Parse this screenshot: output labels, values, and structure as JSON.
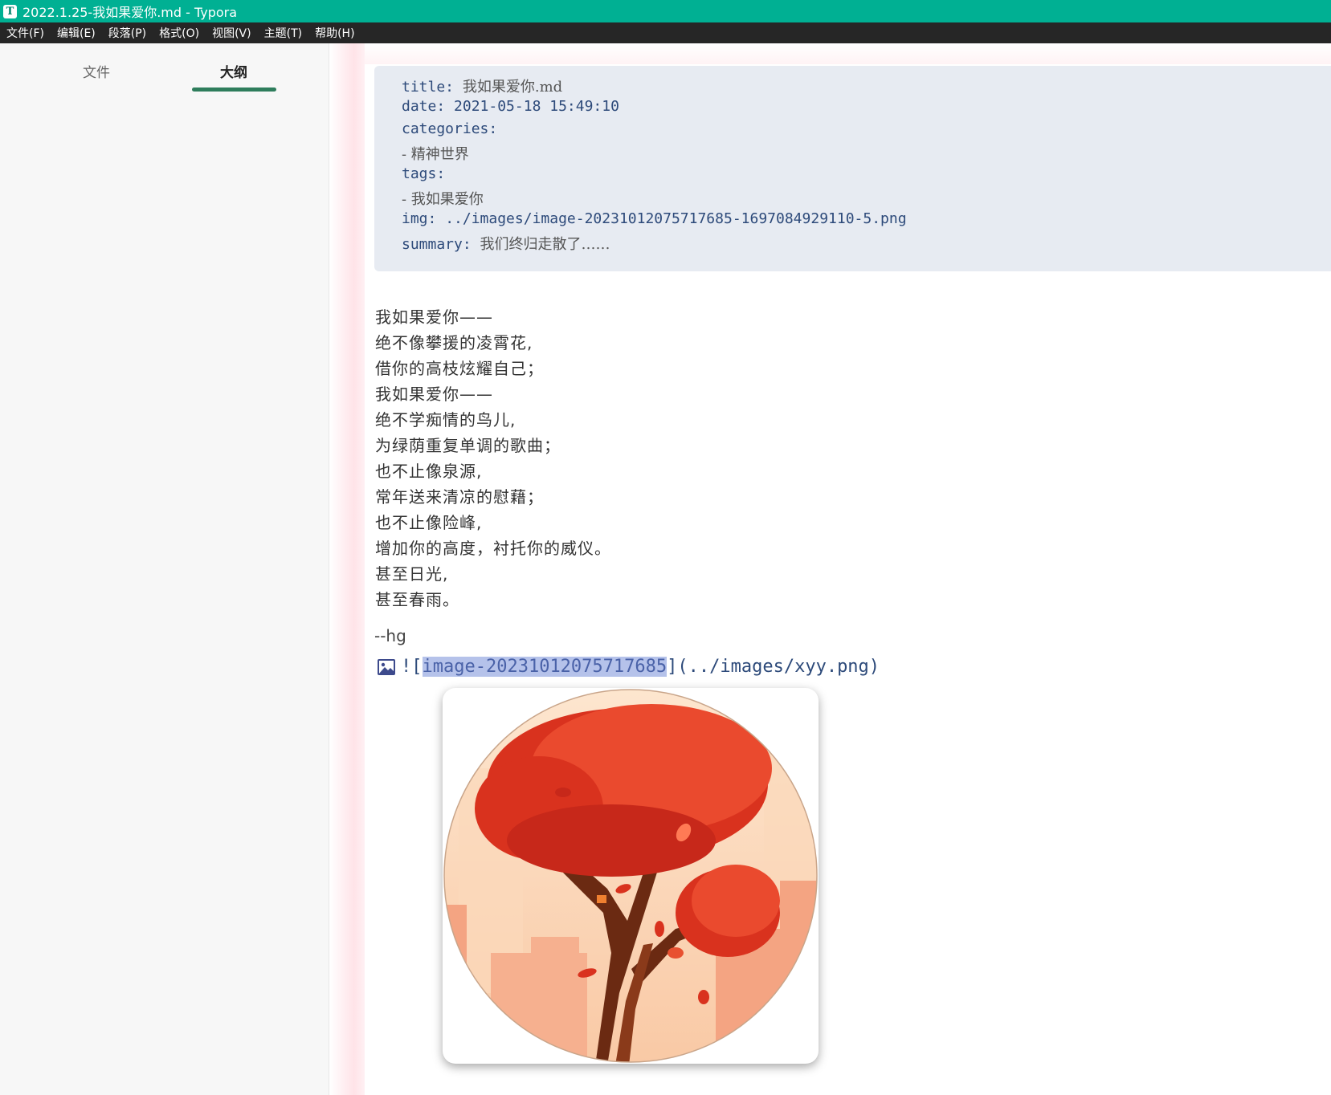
{
  "window": {
    "title": "2022.1.25-我如果爱你.md - Typora",
    "app_icon_letter": "T"
  },
  "menu": [
    "文件(F)",
    "编辑(E)",
    "段落(P)",
    "格式(O)",
    "视图(V)",
    "主题(T)",
    "帮助(H)"
  ],
  "sidebar": {
    "tabs": [
      {
        "label": "文件",
        "active": false
      },
      {
        "label": "大纲",
        "active": true
      }
    ],
    "accent_color": "#2e7d5c"
  },
  "front_matter": {
    "title_key": "title:",
    "title_value": "我如果爱你.md",
    "date_key": "date:",
    "date_value": "2021-05-18 15:49:10",
    "categories_key": "categories:",
    "categories_item": "- 精神世界",
    "tags_key": "tags:",
    "tags_item": "- 我如果爱你",
    "img_key": "img:",
    "img_value": "../images/image-20231012075717685-1697084929110-5.png",
    "summary_key": "summary:",
    "summary_value": "我们终归走散了……"
  },
  "poem": [
    "我如果爱你——",
    "绝不像攀援的凌霄花,",
    "借你的高枝炫耀自己；",
    "我如果爱你——",
    "绝不学痴情的鸟儿,",
    "为绿荫重复单调的歌曲；",
    "也不止像泉源,",
    "常年送来清凉的慰藉；",
    "也不止像险峰,",
    "增加你的高度，衬托你的威仪。",
    "甚至日光,",
    "甚至春雨。"
  ],
  "signature": "--hg",
  "image_markdown": {
    "prefix": "![",
    "alt_selected": "image-20231012075717685",
    "suffix": "](../images/xyy.png)",
    "selection_color": "#b5c2ea"
  },
  "colors": {
    "titlebar": "#00b093",
    "menubar": "#262626",
    "frontmatter_bg": "#e7ebf2"
  }
}
